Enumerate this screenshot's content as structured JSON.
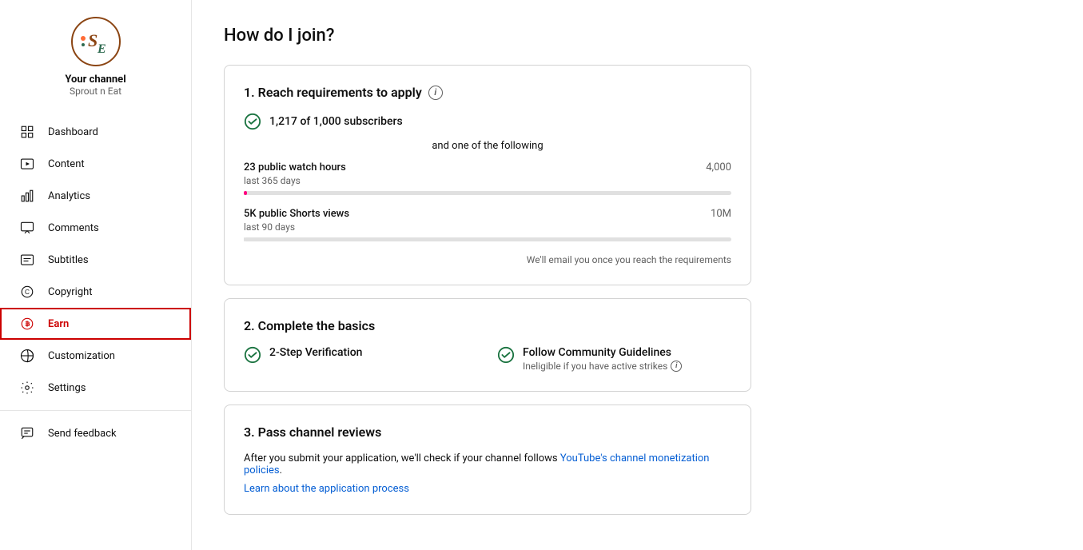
{
  "sidebar": {
    "channel_name": "Your channel",
    "channel_subname": "Sprout n Eat",
    "nav_items": [
      {
        "id": "dashboard",
        "label": "Dashboard",
        "icon": "dashboard"
      },
      {
        "id": "content",
        "label": "Content",
        "icon": "content"
      },
      {
        "id": "analytics",
        "label": "Analytics",
        "icon": "analytics"
      },
      {
        "id": "comments",
        "label": "Comments",
        "icon": "comments"
      },
      {
        "id": "subtitles",
        "label": "Subtitles",
        "icon": "subtitles"
      },
      {
        "id": "copyright",
        "label": "Copyright",
        "icon": "copyright"
      },
      {
        "id": "earn",
        "label": "Earn",
        "icon": "earn",
        "active": true
      },
      {
        "id": "customization",
        "label": "Customization",
        "icon": "customization"
      },
      {
        "id": "settings",
        "label": "Settings",
        "icon": "settings"
      },
      {
        "id": "send-feedback",
        "label": "Send feedback",
        "icon": "feedback"
      }
    ]
  },
  "main": {
    "page_title": "How do I join?",
    "card1": {
      "section_title": "1. Reach requirements to apply",
      "subscribers_text": "1,217 of 1,000 subscribers",
      "and_text": "and one of the following",
      "watch_hours_label": "23 public watch hours",
      "watch_hours_sub": "last 365 days",
      "watch_hours_max": "4,000",
      "watch_hours_pct": 0.575,
      "shorts_label": "5K public Shorts views",
      "shorts_sub": "last 90 days",
      "shorts_max": "10M",
      "shorts_pct": 0.05,
      "email_note": "We'll email you once you reach the requirements"
    },
    "card2": {
      "section_title": "2. Complete the basics",
      "item1_label": "2-Step Verification",
      "item2_label": "Follow Community Guidelines",
      "item2_sub": "Ineligible if you have active strikes"
    },
    "card3": {
      "section_title": "3. Pass channel reviews",
      "review_text_pre": "After you submit your application, we'll check if your channel follows ",
      "review_link_text": "YouTube's channel monetization policies",
      "review_text_post": ".",
      "learn_link": "Learn about the application process"
    }
  }
}
